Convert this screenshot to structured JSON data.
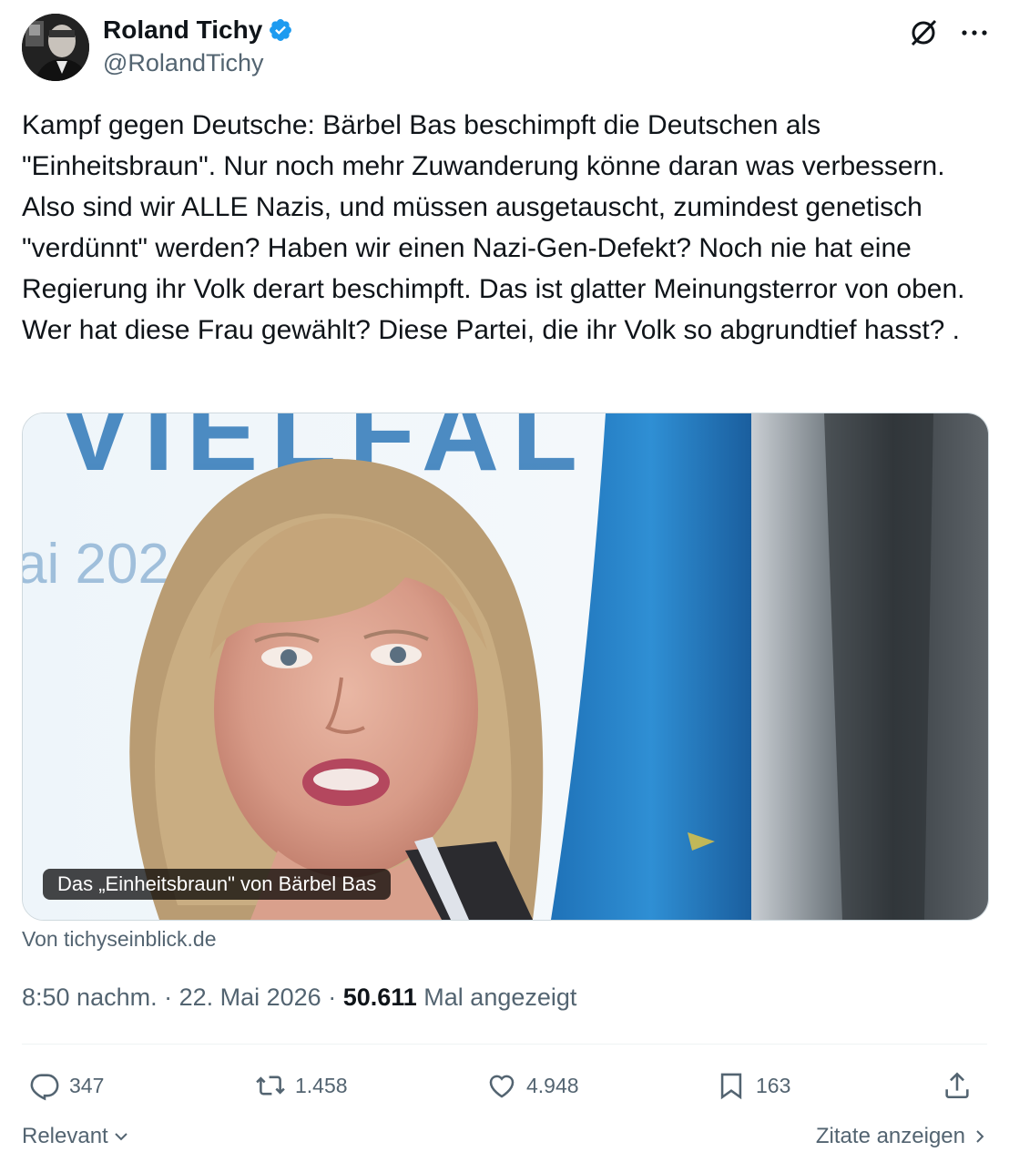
{
  "author": {
    "name": "Roland Tichy",
    "handle": "@RolandTichy",
    "verified_color": "#1d9bf0"
  },
  "tweet": {
    "text": "Kampf gegen Deutsche: Bärbel Bas beschimpft die Deutschen als \"Einheitsbraun\". Nur noch mehr Zuwanderung könne daran was verbessern. Also sind wir ALLE Nazis, und müssen ausgetauscht, zumindest genetisch \"verdünnt\" werden? Haben wir einen Nazi-Gen-Defekt? Noch nie hat eine Regierung ihr Volk derart beschimpft. Das ist glatter Meinungsterror von oben. Wer hat diese Frau gewählt? Diese Partei, die ihr Volk so abgrundtief hasst? ."
  },
  "media": {
    "caption": "Das „Einheitsbraun\" von Bärbel Bas",
    "bg_text_top": "VIELFALT",
    "bg_text_side": "ai 202",
    "source": "Von tichyseinblick.de"
  },
  "meta": {
    "time": "8:50 nachm.",
    "sep1": " · ",
    "date": "22. Mai 2026",
    "sep2": " · ",
    "views": "50.611",
    "views_label": " Mal angezeigt"
  },
  "actions": {
    "replies": "347",
    "reposts": "1.458",
    "likes": "4.948",
    "bookmarks": "163"
  },
  "footer": {
    "sort_label": "Relevant",
    "quotes_label": "Zitate anzeigen"
  },
  "icons": [
    "verified-badge-icon",
    "grok-icon",
    "more-icon",
    "reply-icon",
    "repost-icon",
    "like-icon",
    "bookmark-icon",
    "share-icon",
    "chevron-down-icon",
    "chevron-right-icon"
  ]
}
